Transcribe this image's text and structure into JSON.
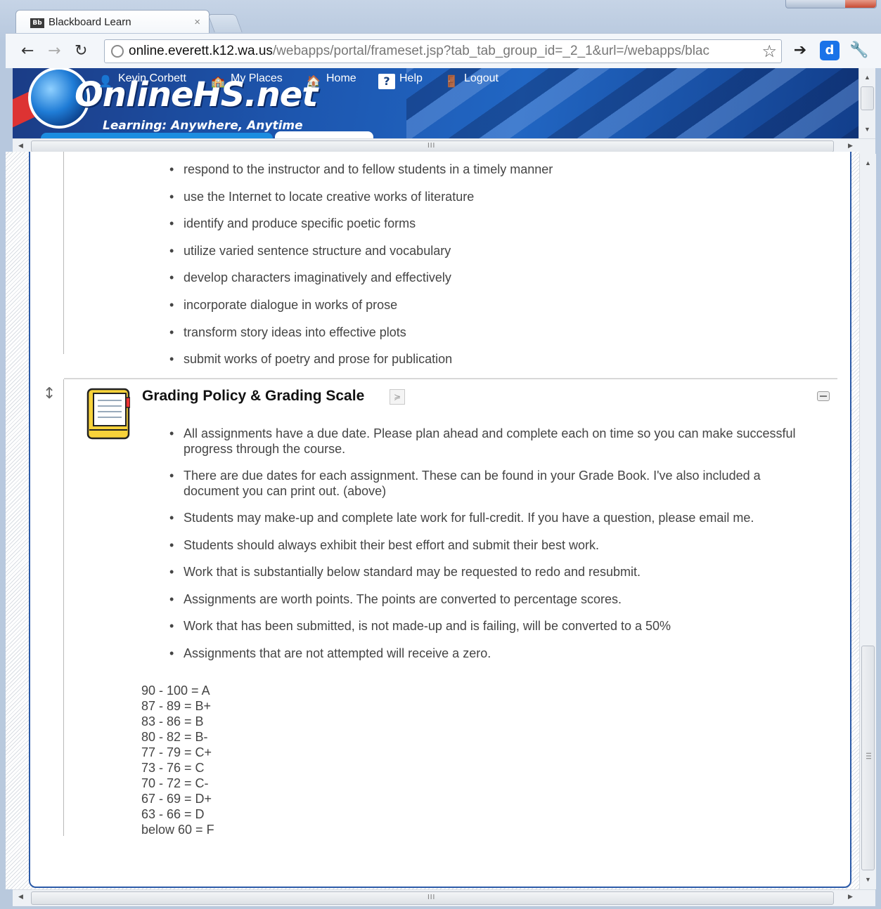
{
  "browser": {
    "tab_title": "Blackboard Learn",
    "tab_favicon": "Bb",
    "tab_close": "×",
    "url_host": "online.everett.k12.wa.us",
    "url_path": "/webapps/portal/frameset.jsp?tab_tab_group_id=_2_1&url=/webapps/blac",
    "icons": [
      "back-icon",
      "forward-icon",
      "reload-icon",
      "page-icon",
      "bookmark-star-icon",
      "extension-icon",
      "extension-d-icon",
      "wrench-icon"
    ]
  },
  "banner": {
    "logo_text": "OnlineHS.net",
    "tagline": "Learning: Anywhere, Anytime",
    "nav": {
      "user": "Kevin Corbett",
      "my_places": "My Places",
      "home": "Home",
      "help": "Help",
      "logout": "Logout"
    },
    "colors": {
      "banner_blue": "#1d57b0",
      "accent_red": "#dd3333"
    }
  },
  "outcomes": {
    "items": [
      "respond to the instructor and to fellow students in a timely manner",
      "use the Internet to locate creative works of literature",
      "identify and produce specific poetic forms",
      "utilize varied sentence structure and vocabulary",
      "develop characters imaginatively and effectively",
      "incorporate dialogue in works of prose",
      "transform story ideas into effective plots",
      "submit works of poetry and prose for publication"
    ]
  },
  "grading": {
    "title": "Grading Policy & Grading Scale",
    "chevron": "≽",
    "items": [
      "All assignments have a due date. Please plan ahead and complete each on time so you can make successful progress through the course.",
      "There are due dates for each assignment. These can be found in your Grade Book. I've also included a document you can print out. (above)",
      "Students may make-up and complete late work for full-credit. If you have a question, please email me.",
      "Students should always exhibit their best effort and submit their best work.",
      "Work that is substantially below standard may be requested to redo and resubmit.",
      "Assignments are worth points. The points are converted to percentage scores.",
      "Work that has been submitted, is not made-up and is failing, will be converted to a 50%",
      "Assignments that are not attempted will receive a zero."
    ],
    "scale": [
      "90 - 100 = A",
      "87 - 89 = B+",
      "83 - 86 = B",
      "80 - 82 = B-",
      "77 - 79 = C+",
      "73 - 76 = C",
      "70 - 72 = C-",
      "67 - 69 = D+",
      "63 - 66 = D",
      "below 60 = F"
    ]
  },
  "scrollbars": {
    "grip": "III"
  }
}
